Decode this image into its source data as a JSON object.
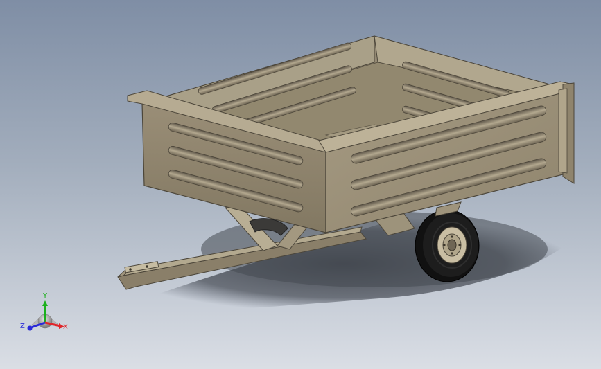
{
  "viewport": {
    "model": "dump-cart-trailer",
    "colors": {
      "body_light": "#9c9079",
      "body_mid": "#847a65",
      "body_dark": "#5b5444",
      "rim": "#c2b79c",
      "tire": "#161616",
      "shadow": "#4a4e56"
    }
  },
  "triad": {
    "x_label": "X",
    "y_label": "Y",
    "z_label": "Z",
    "x_color": "#e0262b",
    "y_color": "#1bb01b",
    "z_color": "#2a2ad8"
  }
}
